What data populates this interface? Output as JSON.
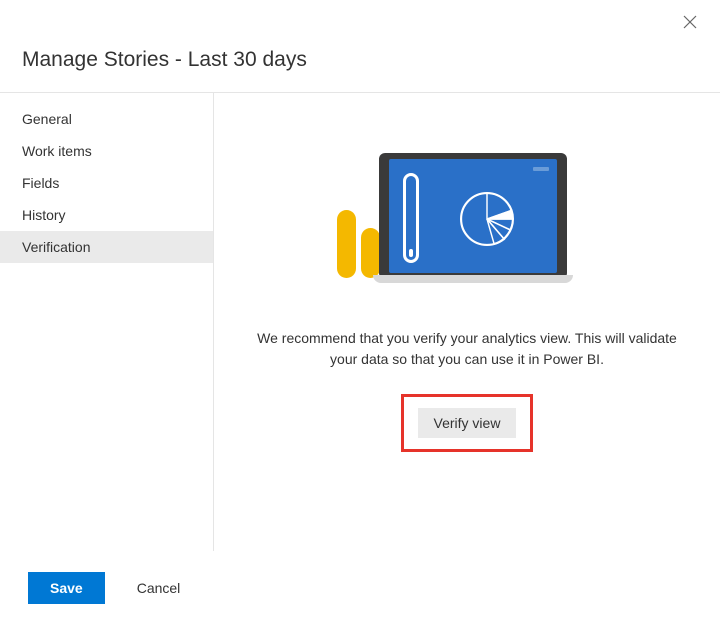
{
  "header": {
    "title": "Manage Stories - Last 30 days"
  },
  "sidebar": {
    "items": [
      {
        "label": "General",
        "selected": false
      },
      {
        "label": "Work items",
        "selected": false
      },
      {
        "label": "Fields",
        "selected": false
      },
      {
        "label": "History",
        "selected": false
      },
      {
        "label": "Verification",
        "selected": true
      }
    ]
  },
  "content": {
    "description": "We recommend that you verify your analytics view. This will validate your data so that you can use it in Power BI.",
    "verify_button_label": "Verify view"
  },
  "footer": {
    "save_label": "Save",
    "cancel_label": "Cancel"
  },
  "icons": {
    "close": "✕"
  }
}
